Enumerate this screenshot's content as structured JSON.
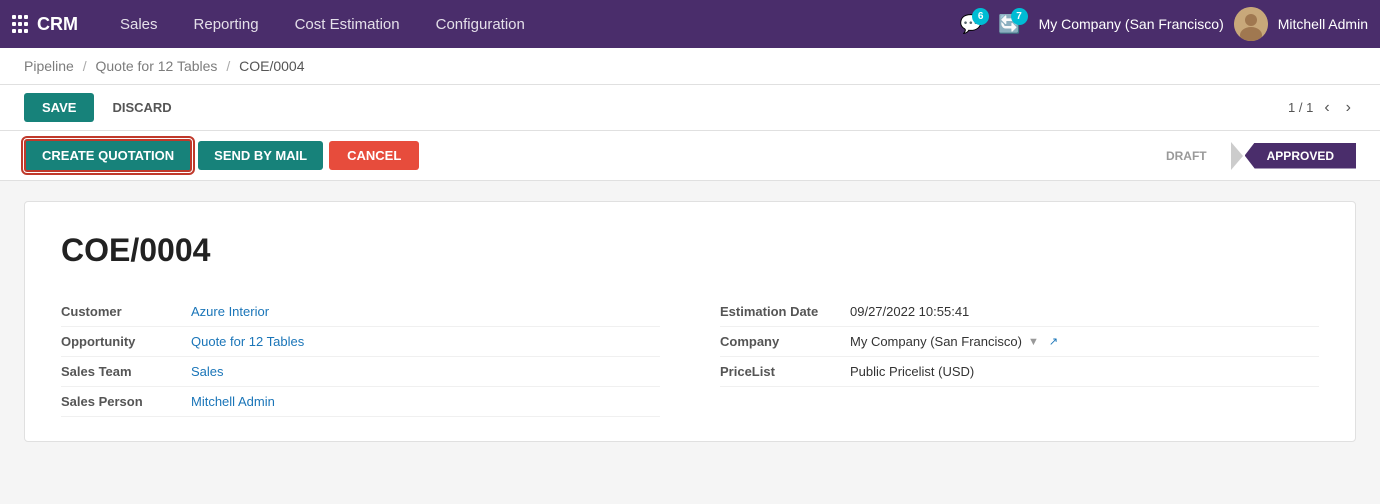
{
  "topnav": {
    "logo": "CRM",
    "menu_items": [
      "Sales",
      "Reporting",
      "Cost Estimation",
      "Configuration"
    ],
    "chat_badge": "6",
    "activity_badge": "7",
    "company": "My Company (San Francisco)",
    "username": "Mitchell Admin"
  },
  "breadcrumb": {
    "items": [
      "Pipeline",
      "Quote for 12 Tables",
      "COE/0004"
    ],
    "separators": [
      "/",
      "/"
    ]
  },
  "action_bar": {
    "save_label": "SAVE",
    "discard_label": "DISCARD",
    "pagination": "1 / 1"
  },
  "workflow": {
    "create_quotation_label": "CREATE QUOTATION",
    "send_by_mail_label": "SEND BY MAIL",
    "cancel_label": "CANCEL",
    "status_draft": "DRAFT",
    "status_approved": "APPROVED"
  },
  "document": {
    "title": "COE/0004",
    "left_fields": [
      {
        "label": "Customer",
        "value": "Azure Interior",
        "type": "link"
      },
      {
        "label": "Opportunity",
        "value": "Quote for 12 Tables",
        "type": "link"
      },
      {
        "label": "Sales Team",
        "value": "Sales",
        "type": "link"
      },
      {
        "label": "Sales Person",
        "value": "Mitchell Admin",
        "type": "link"
      }
    ],
    "right_fields": [
      {
        "label": "Estimation Date",
        "value": "09/27/2022 10:55:41",
        "type": "plain"
      },
      {
        "label": "Company",
        "value": "My Company (San Francisco)",
        "type": "dropdown"
      },
      {
        "label": "PriceList",
        "value": "Public Pricelist (USD)",
        "type": "plain"
      }
    ]
  }
}
